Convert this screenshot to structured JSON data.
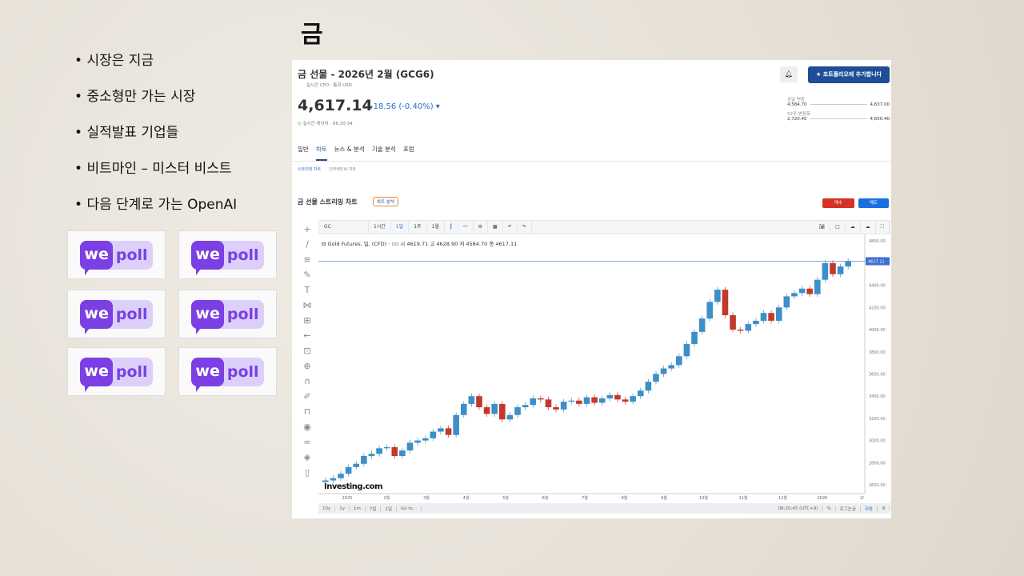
{
  "slide": {
    "title": "금",
    "bullets": [
      "시장은 지금",
      "중소형만 가는 시장",
      "실적발표 기업들",
      "비트마인 – 미스터 비스트",
      "다음 단계로 가는 OpenAI"
    ],
    "logo_text": [
      "we",
      "poll"
    ]
  },
  "quote": {
    "title": "금 선물 - 2026년 2월 (GCG6)",
    "sub1": "실시간 CFD",
    "sub2": "통화 USD",
    "price": "4,617.14",
    "change": "-18.56 (-0.40%)",
    "time": "실시간 데이터 · 06:20:34",
    "add_portfolio": "포트폴리오에 추가합니다",
    "day_range_label": "금일 변동",
    "day_low": "4,584.70",
    "day_high": "4,637.00",
    "week52_label": "52주 변동폭",
    "w52_low": "2,720.40",
    "w52_high": "4,650.40"
  },
  "tabs": [
    "일반",
    "차트",
    "뉴스 & 분석",
    "기술 분석",
    "포럼"
  ],
  "subtabs": [
    "스트리밍 차트",
    "인터랙티브 차트"
  ],
  "chart_header": {
    "title": "금 선물 스트리밍 차트",
    "analysis": "차트 분석",
    "buy": "매수",
    "sell": "매도"
  },
  "toolbar": {
    "symbol": "GC",
    "items": [
      "1시간",
      "1일",
      "1주",
      "1월"
    ]
  },
  "legend": {
    "name": "Gold Futures, 일, (CFD)",
    "o": "시 4619.71",
    "h": "고 4628.90",
    "l": "저 4584.70",
    "c": "종 4617.11"
  },
  "bottom": {
    "ranges": [
      "10y",
      "1y",
      "1m",
      "7일",
      "1일",
      "Go to..."
    ],
    "time": "06:20:45 (UTC+9)",
    "pct": "%",
    "log": "로그눈금",
    "auto": "자동"
  },
  "watermark": "Investing.com",
  "colors": {
    "up": "#3c8fc7",
    "down": "#c0392b",
    "accent": "#1f4e96"
  },
  "chart_data": {
    "type": "candlestick",
    "title": "Gold Futures, 일, (CFD)",
    "last_label": "4617.11",
    "yticks": [
      2600,
      2800,
      3000,
      3200,
      3400,
      3600,
      3800,
      4000,
      4200,
      4400,
      4800
    ],
    "ylim": [
      2550,
      4830
    ],
    "xticks": [
      "2025",
      "2월",
      "3월",
      "4월",
      "5월",
      "6월",
      "7월",
      "8월",
      "9월",
      "10월",
      "11월",
      "12월",
      "2026",
      "2/"
    ],
    "closes": [
      2640,
      2660,
      2700,
      2760,
      2790,
      2860,
      2880,
      2930,
      2940,
      2860,
      2910,
      2980,
      3000,
      3020,
      3080,
      3110,
      3050,
      3230,
      3330,
      3400,
      3300,
      3240,
      3330,
      3190,
      3230,
      3300,
      3320,
      3380,
      3370,
      3300,
      3280,
      3350,
      3360,
      3330,
      3390,
      3340,
      3380,
      3410,
      3370,
      3350,
      3400,
      3450,
      3530,
      3600,
      3650,
      3680,
      3760,
      3870,
      3980,
      4100,
      4250,
      4360,
      4130,
      4000,
      3990,
      4050,
      4080,
      4150,
      4080,
      4200,
      4300,
      4330,
      4370,
      4320,
      4450,
      4600,
      4500,
      4570,
      4617
    ]
  }
}
